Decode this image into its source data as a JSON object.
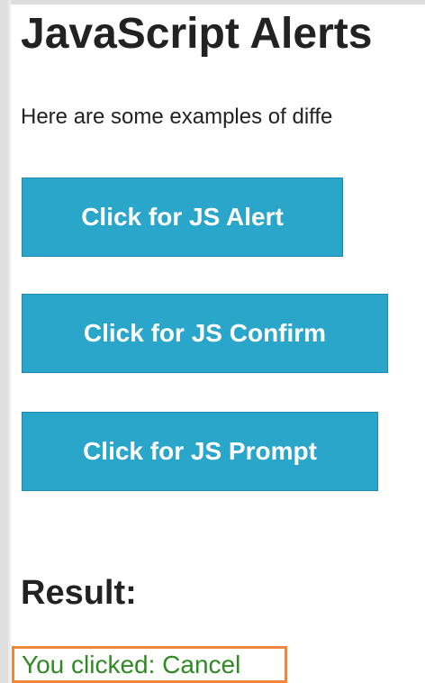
{
  "page": {
    "title": "JavaScript Alerts",
    "intro": "Here are some examples of diffe"
  },
  "buttons": {
    "alert_label": "Click for JS Alert",
    "confirm_label": "Click for JS Confirm",
    "prompt_label": "Click for JS Prompt"
  },
  "result": {
    "heading": "Result:",
    "text": "You clicked: Cancel"
  },
  "colors": {
    "button_bg": "#2ba6cb",
    "button_text": "#ffffff",
    "result_text": "#2e8b22",
    "highlight_border": "#f0873c"
  }
}
